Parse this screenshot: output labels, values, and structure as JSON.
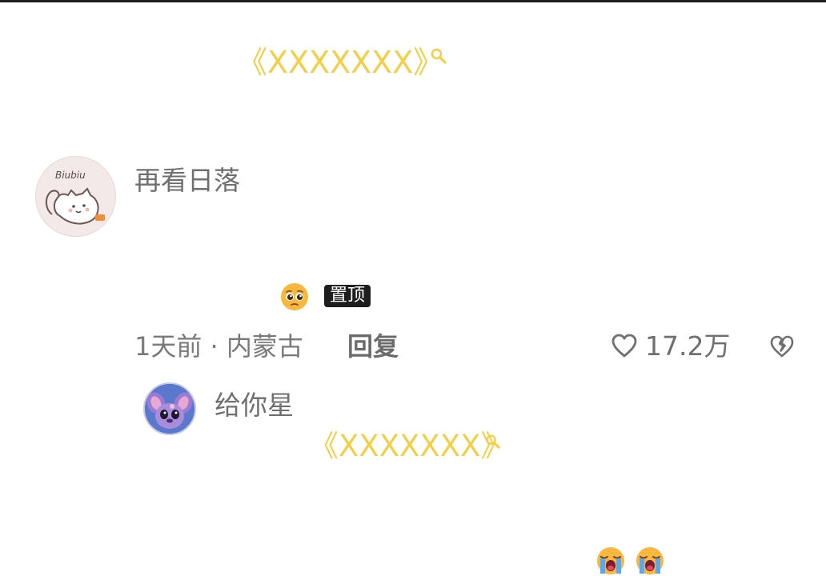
{
  "comment": {
    "link_text": "《XXXXXXX》",
    "username": "再看日落",
    "avatar_text": "Biubiu",
    "pin_label": "置顶",
    "time_location": "1天前 · 内蒙古",
    "reply_label": "回复",
    "like_count": "17.2万"
  },
  "reply": {
    "username": "给你星",
    "link_text": "《XXXXXXX》"
  },
  "colors": {
    "link": "#f3cf48",
    "pin_badge_bg": "#1e1e1e",
    "text_gray": "#6f6f6f"
  },
  "icons": {
    "link_search": "search-icon",
    "pleading": "pleading-face-emoji",
    "like": "heart-outline-icon",
    "dislike": "broken-heart-icon",
    "crying": "loudly-crying-face-emoji"
  }
}
